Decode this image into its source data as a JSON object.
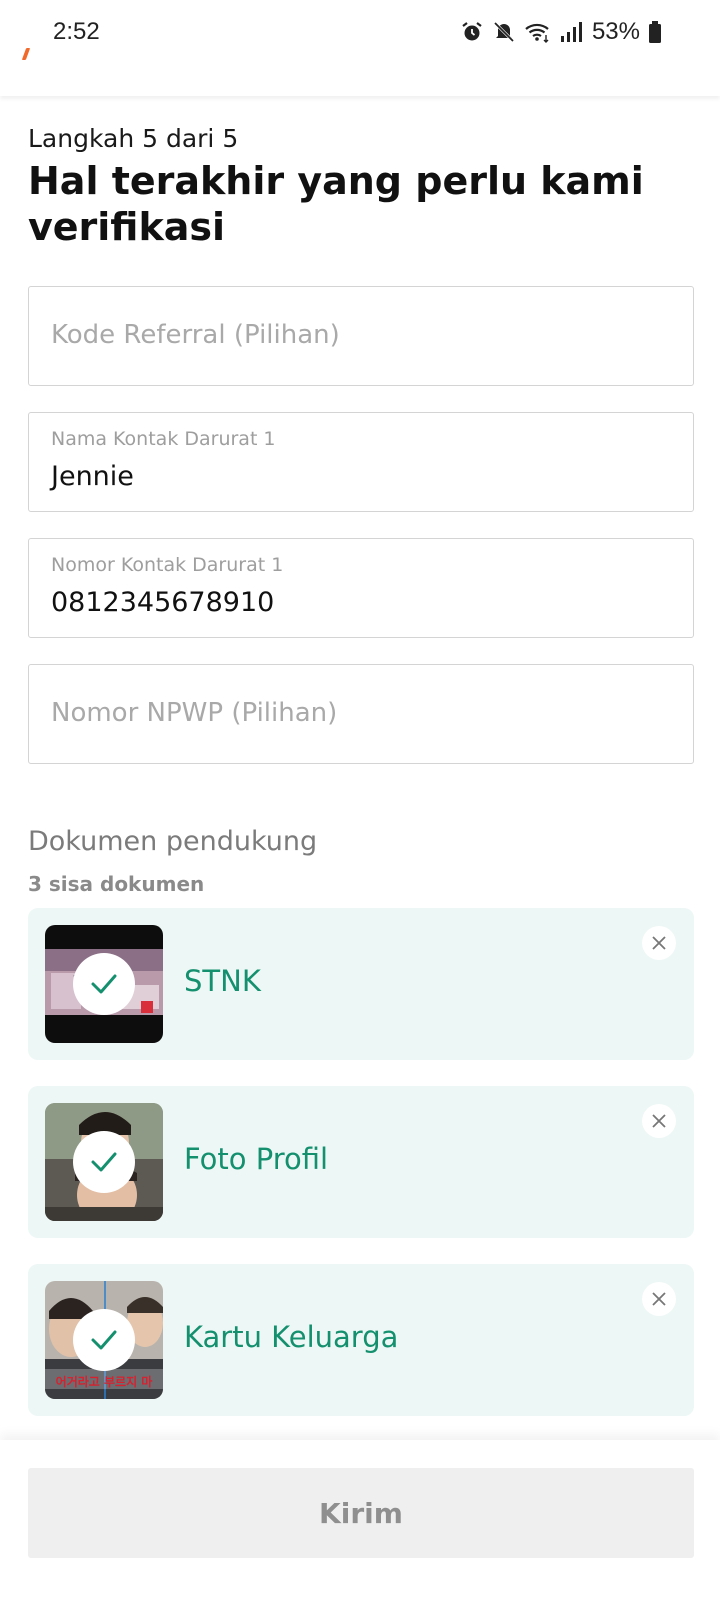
{
  "status_bar": {
    "time": "2:52",
    "battery": "53%"
  },
  "form": {
    "step": "Langkah 5 dari 5",
    "title": "Hal terakhir yang perlu kami verifikasi",
    "fields": [
      {
        "placeholder": "Kode Referral (Pilihan)"
      },
      {
        "label": "Nama Kontak Darurat 1",
        "value": "Jennie"
      },
      {
        "label": "Nomor Kontak Darurat 1",
        "value": "0812345678910"
      },
      {
        "placeholder": "Nomor NPWP (Pilihan)"
      }
    ]
  },
  "documents": {
    "title": "Dokumen pendukung",
    "remaining": "3 sisa dokumen",
    "items": [
      {
        "label": "STNK",
        "status": "uploaded"
      },
      {
        "label": "Foto Profil",
        "status": "uploaded"
      },
      {
        "label": "Kartu Keluarga",
        "status": "uploaded",
        "thumb_text": "어거라고 부르지 마"
      }
    ]
  },
  "actions": {
    "submit_label": "Kirim"
  },
  "colors": {
    "accent": "#14906f",
    "card_bg": "#edf7f5",
    "disabled_bg": "#efefef",
    "brand": "#f26a2a"
  }
}
